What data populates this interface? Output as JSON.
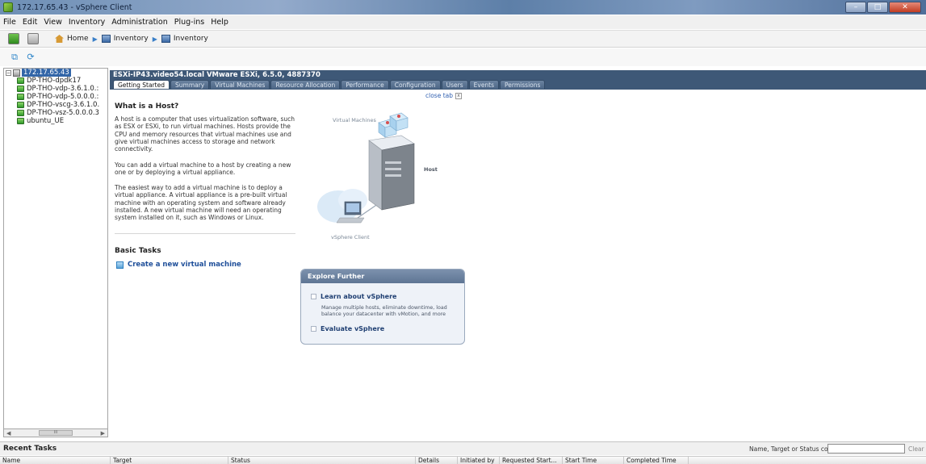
{
  "window": {
    "title": "172.17.65.43 - vSphere Client"
  },
  "menubar": {
    "items": [
      "File",
      "Edit",
      "View",
      "Inventory",
      "Administration",
      "Plug-ins",
      "Help"
    ]
  },
  "breadcrumb": {
    "home": "Home",
    "inventory1": "Inventory",
    "inventory2": "Inventory"
  },
  "tree": {
    "host": "172.17.65.43",
    "vms": [
      "DP-THO-dpdk17",
      "DP-THO-vdp-3.6.1.0.:",
      "DP-THO-vdp-5.0.0.0.:",
      "DP-THO-vscg-3.6.1.0.",
      "DP-THO-vsz-5.0.0.0.3",
      "ubuntu_UE"
    ],
    "scroll_thumb": "III"
  },
  "content": {
    "host_title": "ESXi-IP43.video54.local VMware ESXi, 6.5.0, 4887370",
    "tabs": [
      "Getting Started",
      "Summary",
      "Virtual Machines",
      "Resource Allocation",
      "Performance",
      "Configuration",
      "Users",
      "Events",
      "Permissions"
    ],
    "active_tab": "Getting Started",
    "close_tab": "close tab",
    "heading": "What is a Host?",
    "paragraphs": [
      "A host is a computer that uses virtualization software, such as ESX or ESXi, to run virtual machines. Hosts provide the CPU and memory resources that virtual machines use and give virtual machines access to storage and network connectivity.",
      "You can add a virtual machine to a host by creating a new one or by deploying a virtual appliance.",
      "The easiest way to add a virtual machine is to deploy a virtual appliance. A virtual appliance is a pre-built virtual machine with an operating system and software already installed. A new virtual machine will need an operating system installed on it, such as Windows or Linux."
    ],
    "basic_tasks": "Basic Tasks",
    "create_vm": "Create a new virtual machine",
    "diagram": {
      "vms_label": "Virtual Machines",
      "host_label": "Host",
      "client_label": "vSphere Client"
    },
    "explore": {
      "title": "Explore Further",
      "learn": "Learn about vSphere",
      "learn_desc": "Manage multiple hosts, eliminate downtime, load balance your datacenter with vMotion, and more",
      "evaluate": "Evaluate vSphere"
    }
  },
  "recent_tasks": {
    "title": "Recent Tasks",
    "filter_label": "Name, Target or Status contains: •",
    "filter_value": "",
    "clear": "Clear",
    "columns": [
      "Name",
      "Target",
      "Status",
      "Details",
      "Initiated by",
      "Requested Start...",
      "Start Time",
      "Completed Time"
    ]
  },
  "colors": {
    "header_bg": "#3e5877",
    "host_selected": "#3366a8",
    "link": "#1f4f9a"
  }
}
